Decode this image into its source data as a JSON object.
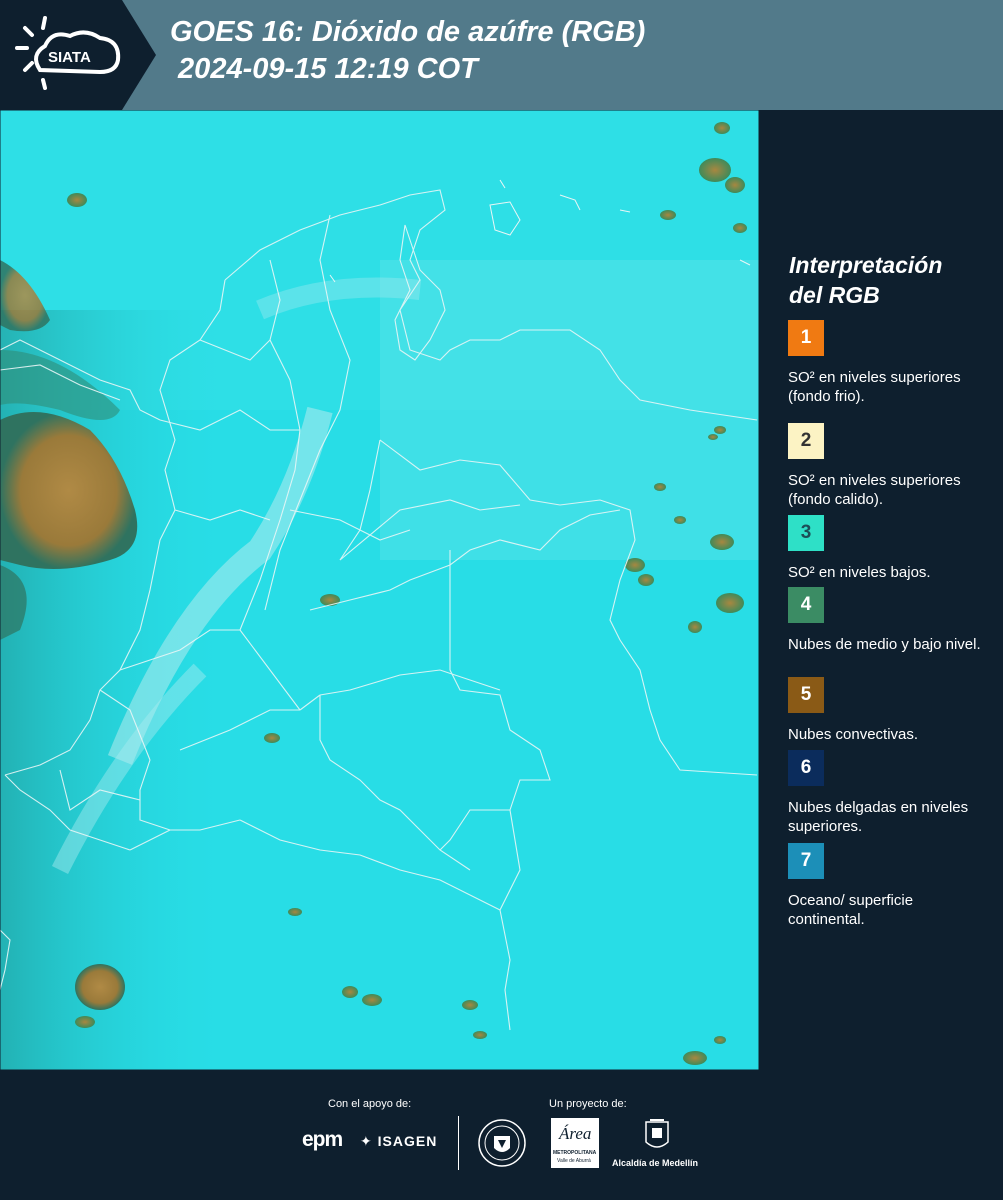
{
  "header": {
    "logo_text": "SIATA",
    "title_line1": "GOES 16: Dióxido de azúfre (RGB)",
    "title_line2": " 2024-09-15 12:19 COT"
  },
  "legend": {
    "title_line1": "Interpretación",
    "title_line2": "del RGB",
    "items": [
      {
        "number": "1",
        "label": "SO² en niveles superiores (fondo frio).",
        "color": "#f07a12",
        "text_color": "#ffffff"
      },
      {
        "number": "2",
        "label": "SO² en niveles superiores (fondo calido).",
        "color": "#fcf3c4",
        "text_color": "#333333"
      },
      {
        "number": "3",
        "label": "SO² en niveles bajos.",
        "color": "#2ee0c7",
        "text_color": "#1c4f57"
      },
      {
        "number": "4",
        "label": "Nubes de medio y bajo nivel.",
        "color": "#3b8c64",
        "text_color": "#ffffff"
      },
      {
        "number": "5",
        "label": "Nubes convectivas.",
        "color": "#8a5a16",
        "text_color": "#ffffff"
      },
      {
        "number": "6",
        "label": "Nubes delgadas en niveles superiores.",
        "color": "#0b2c5c",
        "text_color": "#ffffff"
      },
      {
        "number": "7",
        "label": "Oceano/ superficie continental.",
        "color": "#1c8fb8",
        "text_color": "#ffffff"
      }
    ]
  },
  "footer": {
    "support_label": "Con el apoyo de:",
    "project_label": "Un proyecto de:",
    "sponsor_epm": "epm",
    "sponsor_isagen": "ISAGEN",
    "partner_area": "Área",
    "partner_area_sub": "METROPOLITANA",
    "partner_area_sub2": "Valle de Aburrá",
    "partner_alcaldia": "Alcaldía de Medellín"
  }
}
